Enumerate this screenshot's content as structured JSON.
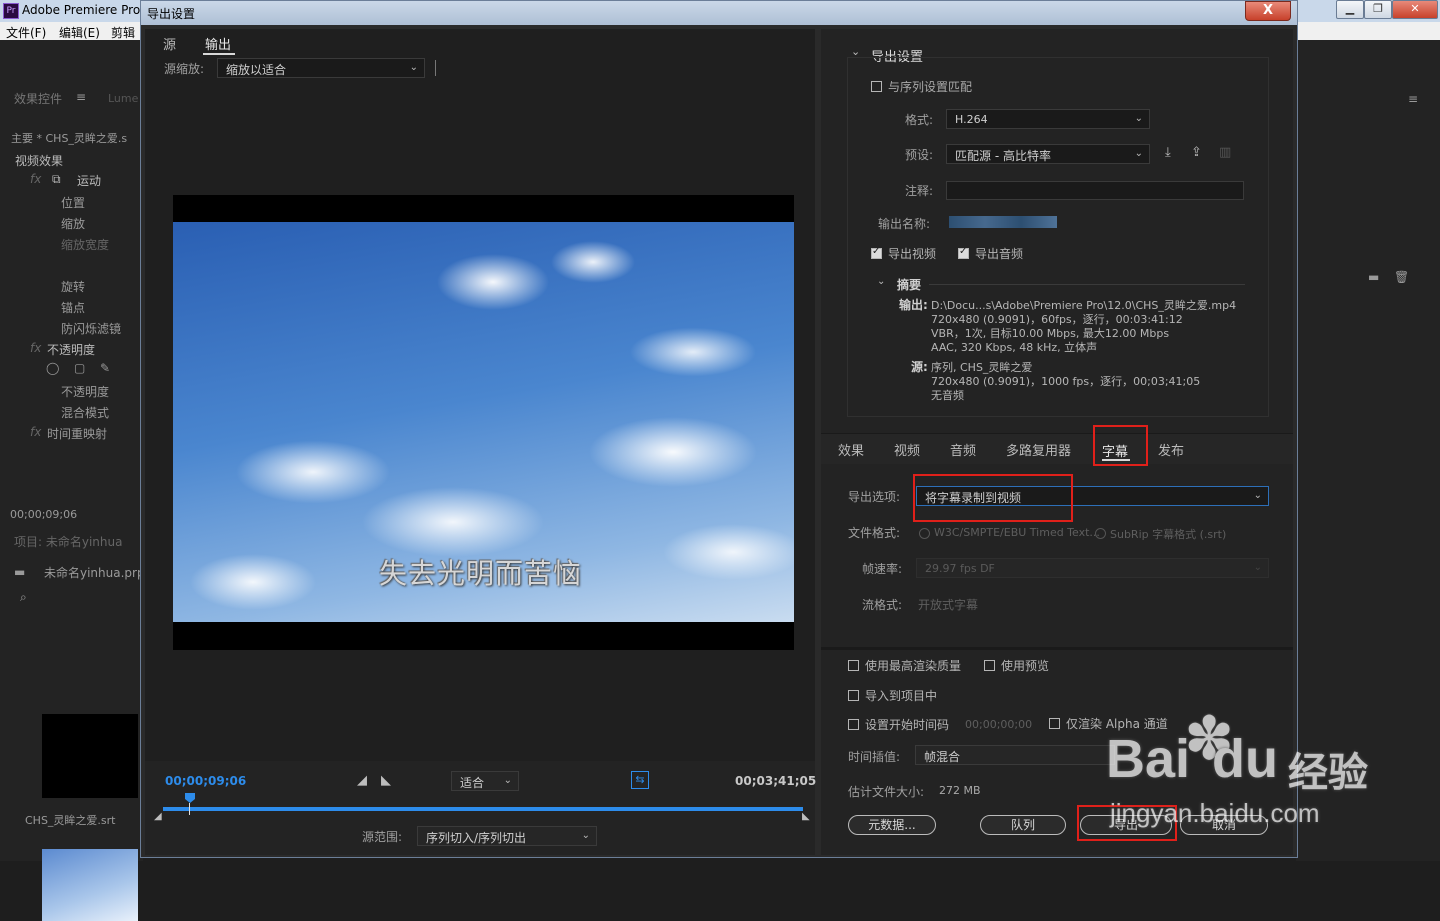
{
  "app": {
    "title": "Adobe Premiere Pro",
    "logo": "Pr"
  },
  "menubar": [
    "文件(F)",
    "编辑(E)",
    "剪辑"
  ],
  "bg_left": {
    "panel_tab": "效果控件",
    "panel_tab2": "Lume",
    "clip_label": "主要 * CHS_灵眸之爱.s",
    "video_effects": "视频效果",
    "items": [
      "运动",
      "位置",
      "缩放",
      "缩放宽度",
      "旋转",
      "锚点",
      "防闪烁滤镜",
      "不透明度",
      "不透明度",
      "混合模式",
      "时间重映射"
    ],
    "timecode": "00;00;09;06",
    "project_tab": "项目: 未命名yinhua",
    "project_file": "未命名yinhua.prpr",
    "clip_name": "CHS_灵眸之爱.srt"
  },
  "dialog": {
    "title": "导出设置",
    "close": "X",
    "tabs": [
      "源",
      "输出"
    ],
    "source_scale_label": "源缩放:",
    "source_scale_value": "缩放以适合",
    "subtitle_text": "失去光明而苦恼",
    "timecode_start": "00;00;09;06",
    "timecode_end": "00;03;41;05",
    "fit_value": "适合",
    "range_label": "源范围:",
    "range_value": "序列切入/序列切出"
  },
  "export": {
    "section_title": "导出设置",
    "match_sequence": "与序列设置匹配",
    "format_label": "格式:",
    "format_value": "H.264",
    "preset_label": "预设:",
    "preset_value": "匹配源 - 高比特率",
    "comment_label": "注释:",
    "output_name_label": "输出名称:",
    "export_video": "导出视频",
    "export_audio": "导出音频",
    "summary_title": "摘要",
    "output_label": "输出:",
    "output_lines": [
      "D:\\Docu...s\\Adobe\\Premiere Pro\\12.0\\CHS_灵眸之爱.mp4",
      "720x480 (0.9091)，60fps，逐行，00:03:41:12",
      "VBR，1次, 目标10.00 Mbps, 最大12.00 Mbps",
      "AAC, 320 Kbps, 48 kHz, 立体声"
    ],
    "source_label": "源:",
    "source_lines": [
      "序列, CHS_灵眸之爱",
      "720x480 (0.9091)，1000 fps，逐行，00;03;41;05",
      "无音频"
    ]
  },
  "settings_tabs": [
    "效果",
    "视频",
    "音频",
    "多路复用器",
    "字幕",
    "发布"
  ],
  "captions": {
    "export_option_label": "导出选项:",
    "export_option_value": "将字幕录制到视频",
    "file_format_label": "文件格式:",
    "format_opt1": "W3C/SMPTE/EBU Timed Text...",
    "format_opt2": "SubRip 字幕格式 (.srt)",
    "fps_label": "帧速率:",
    "fps_value": "29.97 fps DF",
    "stream_label": "流格式:",
    "stream_value": "开放式字幕"
  },
  "bottom": {
    "max_render": "使用最高渲染质量",
    "use_preview": "使用预览",
    "import_project": "导入到项目中",
    "set_start_tc": "设置开始时间码",
    "start_tc_value": "00;00;00;00",
    "alpha_only": "仅渲染 Alpha 通道",
    "interp_label": "时间插值:",
    "interp_value": "帧混合",
    "filesize_label": "估计文件大小:",
    "filesize_value": "272 MB",
    "metadata_btn": "元数据...",
    "queue_btn": "队列",
    "export_btn": "导出",
    "cancel_btn": "取消"
  },
  "watermark": {
    "brand": "Bai",
    "brand2": "du",
    "cn": "经验",
    "url": "jingyan.baidu.com"
  },
  "colors": {
    "accent_blue": "#2d8ceb",
    "highlight_red": "#e0201a"
  }
}
